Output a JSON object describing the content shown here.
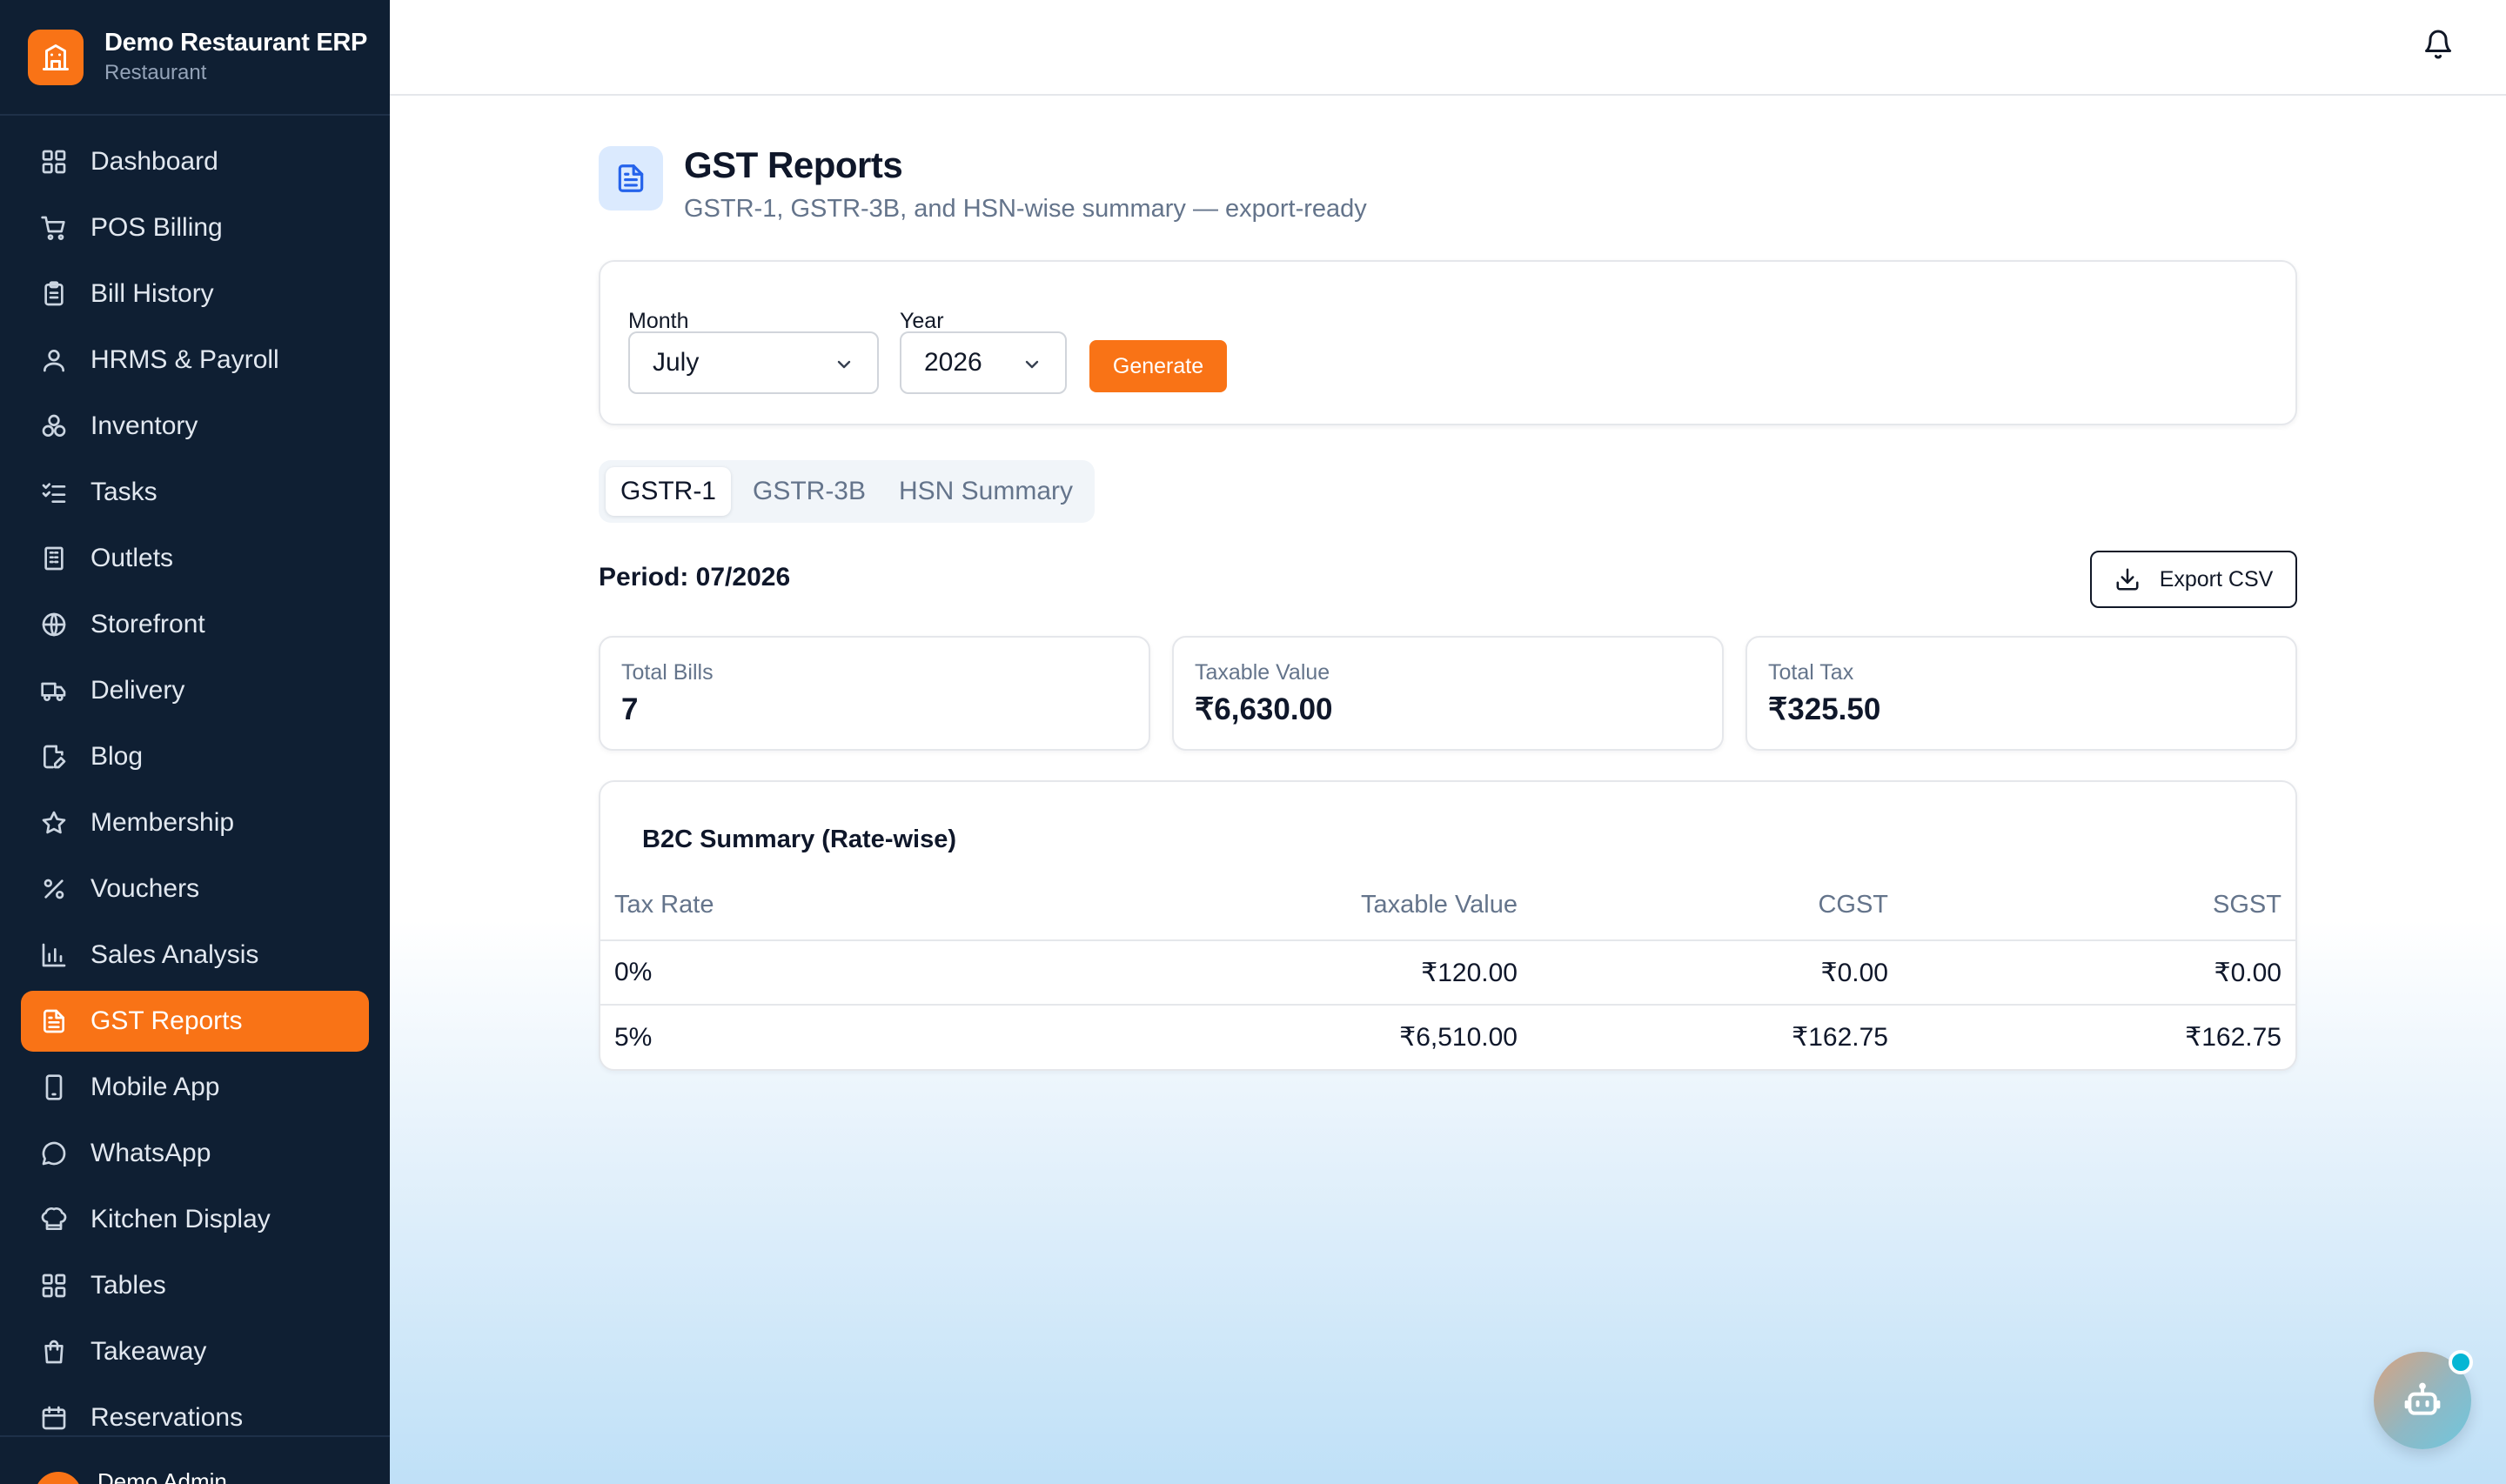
{
  "app": {
    "name": "Demo Restaurant ERP",
    "type": "Restaurant"
  },
  "sidebar": {
    "items": [
      {
        "label": "Dashboard",
        "icon": "grid-icon"
      },
      {
        "label": "POS Billing",
        "icon": "cart-icon"
      },
      {
        "label": "Bill History",
        "icon": "clipboard-icon"
      },
      {
        "label": "HRMS & Payroll",
        "icon": "user-icon"
      },
      {
        "label": "Inventory",
        "icon": "boxes-icon"
      },
      {
        "label": "Tasks",
        "icon": "checklist-icon"
      },
      {
        "label": "Outlets",
        "icon": "building-icon"
      },
      {
        "label": "Storefront",
        "icon": "globe-icon"
      },
      {
        "label": "Delivery",
        "icon": "truck-icon"
      },
      {
        "label": "Blog",
        "icon": "file-pen-icon"
      },
      {
        "label": "Membership",
        "icon": "star-icon"
      },
      {
        "label": "Vouchers",
        "icon": "percent-icon"
      },
      {
        "label": "Sales Analysis",
        "icon": "bar-chart-icon"
      },
      {
        "label": "GST Reports",
        "icon": "file-text-icon",
        "active": true
      },
      {
        "label": "Mobile App",
        "icon": "smartphone-icon"
      },
      {
        "label": "WhatsApp",
        "icon": "message-circle-icon"
      },
      {
        "label": "Kitchen Display",
        "icon": "chef-hat-icon"
      },
      {
        "label": "Tables",
        "icon": "grid-icon"
      },
      {
        "label": "Takeaway",
        "icon": "shopping-bag-icon"
      },
      {
        "label": "Reservations",
        "icon": "calendar-icon"
      }
    ],
    "footer_user": "Demo Admin"
  },
  "page": {
    "title": "GST Reports",
    "subtitle": "GSTR-1, GSTR-3B, and HSN-wise summary — export-ready"
  },
  "filters": {
    "month_label": "Month",
    "month_value": "July",
    "year_label": "Year",
    "year_value": "2026",
    "generate_label": "Generate"
  },
  "tabs": [
    "GSTR-1",
    "GSTR-3B",
    "HSN Summary"
  ],
  "active_tab": "GSTR-1",
  "period": "Period: 07/2026",
  "export_label": "Export CSV",
  "stats": [
    {
      "label": "Total Bills",
      "value": "7"
    },
    {
      "label": "Taxable Value",
      "value": "₹6,630.00"
    },
    {
      "label": "Total Tax",
      "value": "₹325.50"
    }
  ],
  "b2c": {
    "title": "B2C Summary (Rate-wise)",
    "headers": [
      "Tax Rate",
      "Taxable Value",
      "CGST",
      "SGST"
    ],
    "rows": [
      [
        "0%",
        "₹120.00",
        "₹0.00",
        "₹0.00"
      ],
      [
        "5%",
        "₹6,510.00",
        "₹162.75",
        "₹162.75"
      ]
    ]
  },
  "colors": {
    "accent": "#f97316",
    "sidebar_bg": "#0f1f33",
    "page_icon_bg": "#dbeafe",
    "page_icon_fg": "#2563eb"
  }
}
